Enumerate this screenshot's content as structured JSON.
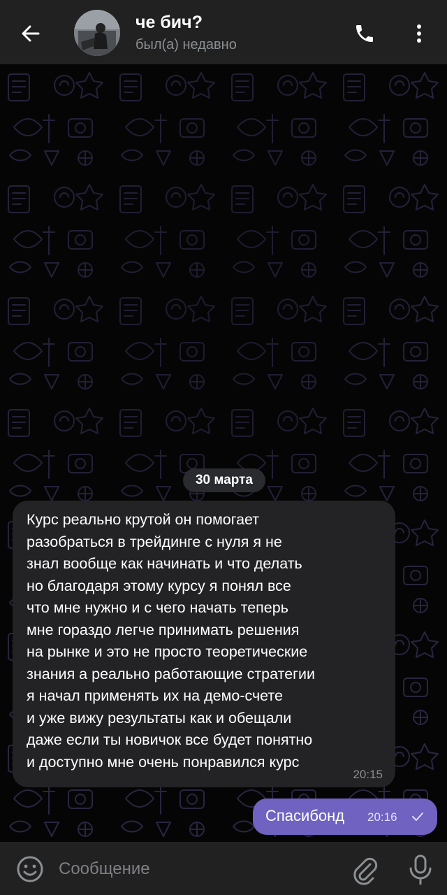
{
  "header": {
    "title": "че бич?",
    "status": "был(а) недавно",
    "icons": {
      "back": "back-arrow-icon",
      "call": "phone-icon",
      "menu": "more-vertical-icon"
    }
  },
  "chat": {
    "date_divider": "30 марта",
    "messages": [
      {
        "direction": "incoming",
        "text": "Курс реально крутой он помогает\nразобраться в трейдинге с нуля я не\nзнал вообще как начинать и что делать\nно благодаря этому курсу я понял все\nчто мне нужно и с чего начать теперь\nмне гораздо легче принимать решения\nна рынке и это не просто теоретические\nзнания а реально работающие стратегии\nя начал применять их на демо-счете\nи уже вижу результаты как и обещали\nдаже если ты новичок все будет понятно\nи доступно мне очень понравился курс",
        "time": "20:15"
      },
      {
        "direction": "outgoing",
        "text": "Спасибонд",
        "time": "20:16",
        "status_icon": "single-check-icon"
      }
    ]
  },
  "input": {
    "placeholder": "Сообщение",
    "icons": {
      "emoji": "emoji-icon",
      "attach": "paperclip-icon",
      "mic": "microphone-icon"
    }
  },
  "colors": {
    "header_bg": "#212121",
    "chat_bg": "#050506",
    "incoming_bubble": "#232326",
    "outgoing_bubble": "#6f62c0",
    "pattern_stroke": "#2b2540"
  }
}
